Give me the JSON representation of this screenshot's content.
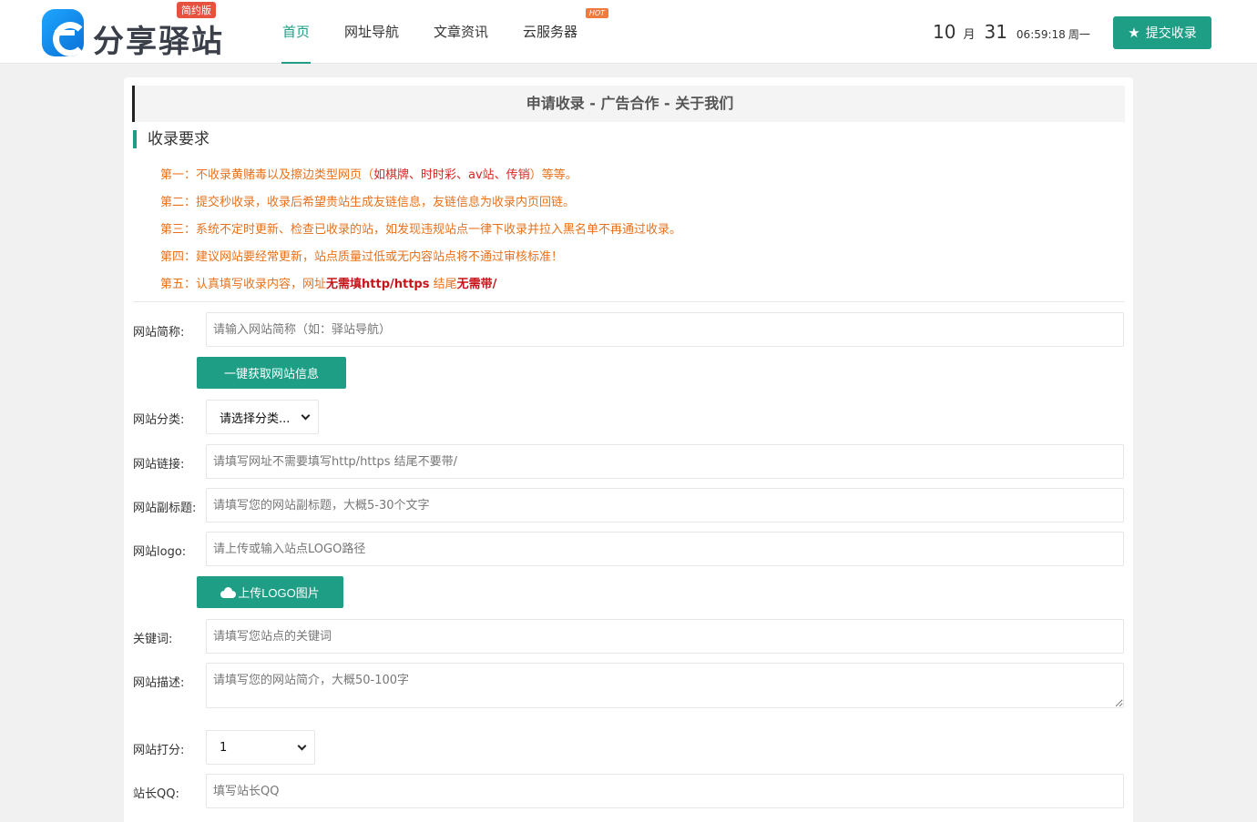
{
  "header": {
    "logo_text": "分享驿站",
    "logo_badge": "简约版",
    "nav": [
      {
        "label": "首页",
        "active": true
      },
      {
        "label": "网址导航",
        "active": false
      },
      {
        "label": "文章资讯",
        "active": false
      },
      {
        "label": "云服务器",
        "active": false,
        "tag": "HOT"
      }
    ],
    "date": {
      "month": "10",
      "month_unit": "月",
      "day": "31",
      "time": "06:59:18",
      "weekday": "周一"
    },
    "submit_label": "提交收录"
  },
  "card": {
    "head_title": "申请收录 - 广告合作 - 关于我们",
    "section_title": "收录要求",
    "rules": [
      {
        "prefix": "第一：不收录黄赌毒以及擦边类型网页（",
        "red": "如棋牌、时时彩、av站、传销",
        "suffix": "）等等。"
      },
      {
        "prefix": "第二：提交秒收录，收录后希望贵站生成友链信息，友链信息为收录内页回链。"
      },
      {
        "prefix": "第三：系统不定时更新、检查已收录的站，如发现违规站点一律下收录并拉入黑名单不再通过收录。"
      },
      {
        "prefix": "第四：建议网站要经常更新，站点质量过低或无内容站点将不通过审核标准！"
      },
      {
        "prefix": "第五：认真填写收录内容，网址",
        "bold1": "无需填http/https",
        "mid": " 结尾",
        "bold2": "无需带/"
      }
    ]
  },
  "form": {
    "site_name": {
      "label": "网站简称:",
      "placeholder": "请输入网站简称（如：驿站导航）"
    },
    "fetch_button": "一键获取网站信息",
    "category": {
      "label": "网站分类:",
      "selected": "请选择分类..."
    },
    "url": {
      "label": "网站链接:",
      "placeholder": "请填写网址不需要填写http/https 结尾不要带/"
    },
    "subtitle": {
      "label": "网站副标题:",
      "placeholder": "请填写您的网站副标题，大概5-30个文字"
    },
    "logo": {
      "label": "网站logo:",
      "placeholder": "请上传或输入站点LOGO路径"
    },
    "upload_button": "上传LOGO图片",
    "keywords": {
      "label": "关键词:",
      "placeholder": "请填写您站点的关键词"
    },
    "description": {
      "label": "网站描述:",
      "placeholder": "请填写您的网站简介，大概50-100字"
    },
    "score": {
      "label": "网站打分:",
      "selected": "1"
    },
    "qq": {
      "label": "站长QQ:",
      "placeholder": "填写站长QQ"
    }
  },
  "colors": {
    "accent": "#1f9e86",
    "orange": "#e8711c",
    "red": "#d9241f"
  }
}
